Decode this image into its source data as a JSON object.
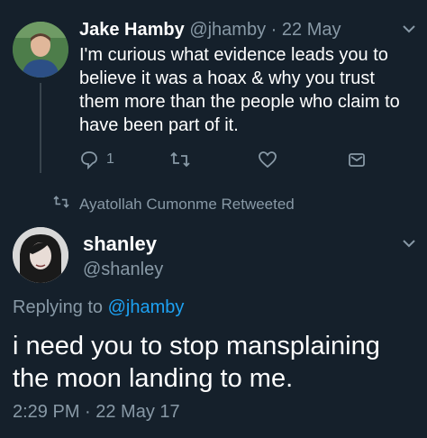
{
  "tweet1": {
    "name": "Jake Hamby",
    "handle": "@jhamby",
    "separator": "·",
    "date": "22 May",
    "text": "I'm curious what evidence leads you to believe it was a hoax & why you trust them more than the people who claim to have been part of it.",
    "reply_count": "1",
    "icons": [
      "reply-icon",
      "retweet-icon",
      "like-icon",
      "share-icon",
      "chevron-down-icon"
    ]
  },
  "retweet_banner": {
    "text": "Ayatollah Cumonme Retweeted",
    "icon": "retweet-icon"
  },
  "tweet2": {
    "name": "shanley",
    "handle": "@shanley",
    "replying_prefix": "Replying to",
    "replying_handle": "@jhamby",
    "text": "i need you to stop mansplaining the moon landing to me.",
    "timestamp": "2:29 PM · 22 May 17"
  },
  "colors": {
    "background": "#15202b",
    "muted": "#8899a6",
    "link": "#1da1f2",
    "text": "#ffffff"
  }
}
